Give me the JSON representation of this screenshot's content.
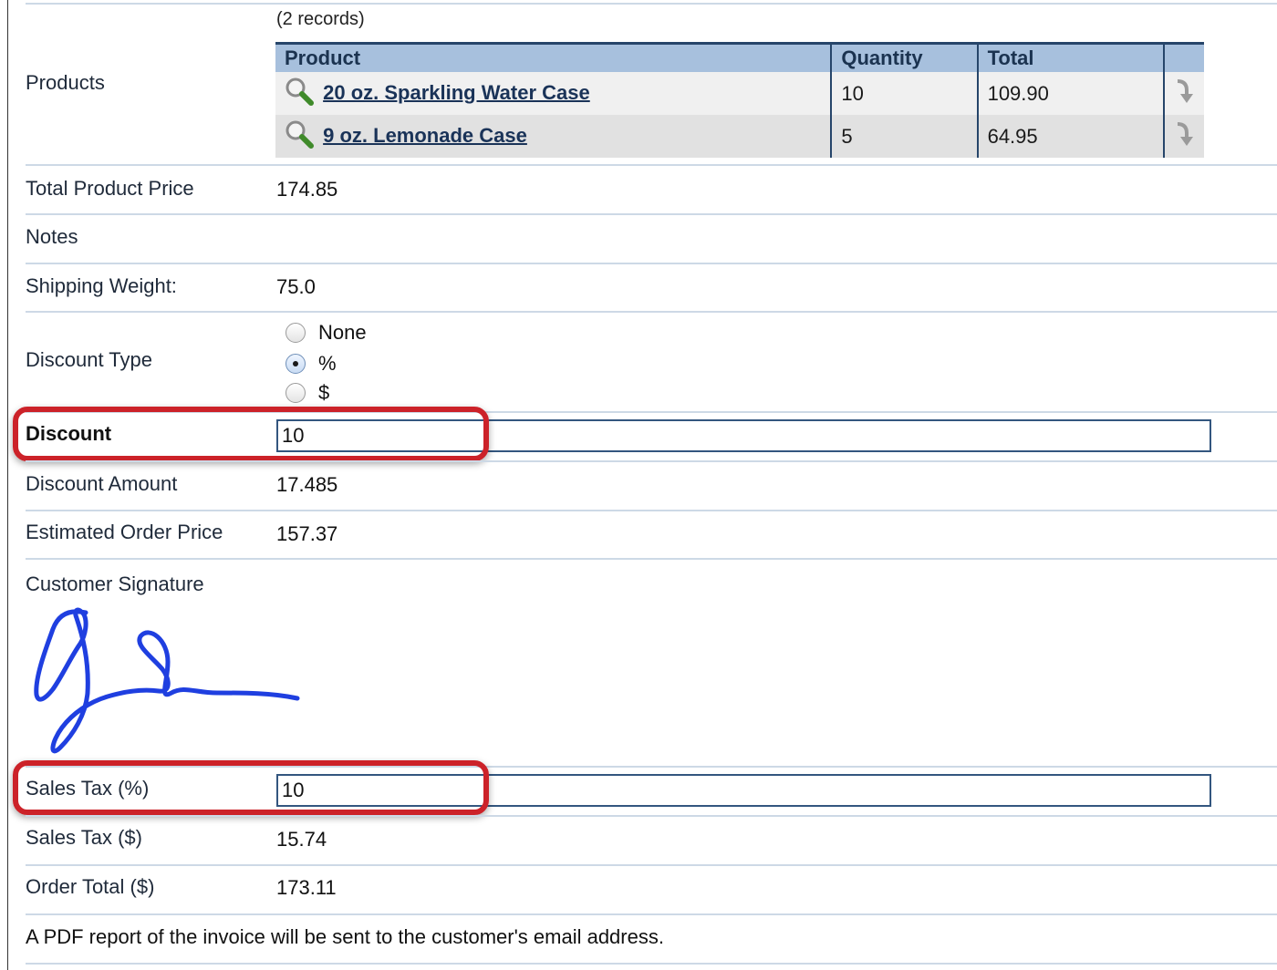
{
  "products": {
    "label": "Products",
    "records_text": "(2 records)",
    "columns": [
      "Product",
      "Quantity",
      "Total",
      ""
    ],
    "rows": [
      {
        "product": "20 oz. Sparkling Water Case",
        "quantity": "10",
        "total": "109.90"
      },
      {
        "product": "9 oz. Lemonade Case",
        "quantity": "5",
        "total": "64.95"
      }
    ]
  },
  "fields": {
    "total_product_price": {
      "label": "Total Product Price",
      "value": "174.85"
    },
    "notes": {
      "label": "Notes",
      "value": ""
    },
    "shipping_weight": {
      "label": "Shipping Weight:",
      "value": "75.0"
    },
    "discount_type": {
      "label": "Discount Type",
      "options": [
        "None",
        "%",
        "$"
      ],
      "selected": "%"
    },
    "discount": {
      "label": "Discount",
      "value": "10"
    },
    "discount_amount": {
      "label": "Discount Amount",
      "value": "17.485"
    },
    "estimated_order_price": {
      "label": "Estimated Order Price",
      "value": "157.37"
    },
    "customer_signature": {
      "label": "Customer Signature"
    },
    "sales_tax_pct": {
      "label": "Sales Tax (%)",
      "value": "10"
    },
    "sales_tax_amt": {
      "label": "Sales Tax ($)",
      "value": "15.74"
    },
    "order_total": {
      "label": "Order Total ($)",
      "value": "173.11"
    }
  },
  "footer_note": "A PDF report of the invoice will be sent to the customer's email address.",
  "colors": {
    "table_header_bg": "#a7c0dd",
    "table_border": "#26456a",
    "row_divider": "#cdd9e6",
    "highlight": "#cc2229",
    "signature_ink": "#1f3fe0"
  }
}
